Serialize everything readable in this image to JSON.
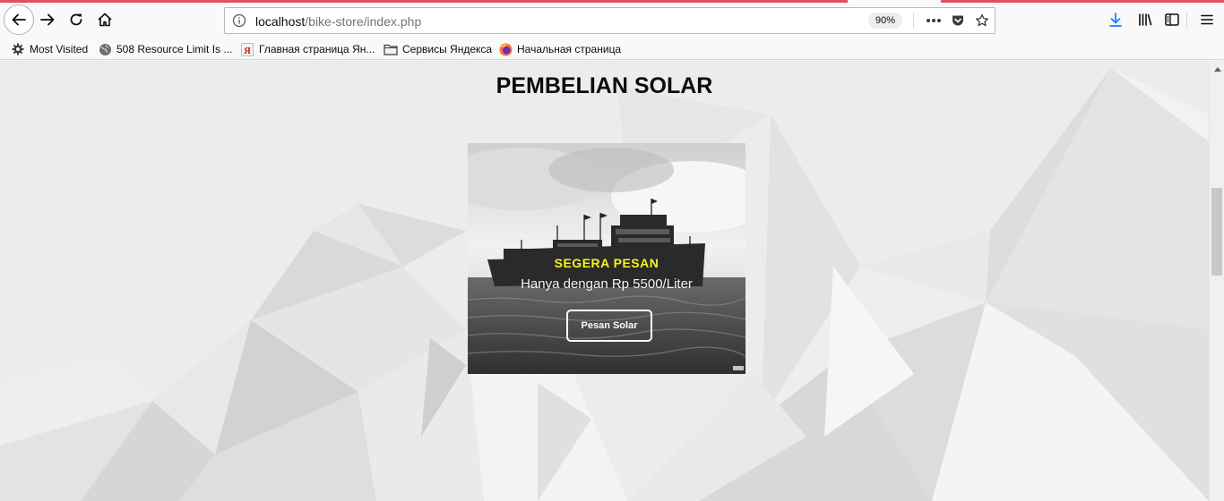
{
  "browser": {
    "url_host": "localhost",
    "url_path": "/bike-store/index.php",
    "zoom": "90%",
    "bookmarks": [
      {
        "label": "Most Visited",
        "icon": "gear-icon"
      },
      {
        "label": "508 Resource Limit Is ...",
        "icon": "globe-icon"
      },
      {
        "label": "Главная страница Ян...",
        "icon": "yandex-icon"
      },
      {
        "label": "Сервисы Яндекса",
        "icon": "folder-icon"
      },
      {
        "label": "Начальная страница",
        "icon": "firefox-icon"
      }
    ],
    "accent_color": "#e0505e"
  },
  "page": {
    "title": "PEMBELIAN SOLAR",
    "card": {
      "heading": "SEGERA PESAN",
      "subtitle": "Hanya dengan Rp 5500/Liter",
      "button_label": "Pesan Solar",
      "heading_color": "#f5f51a"
    }
  }
}
